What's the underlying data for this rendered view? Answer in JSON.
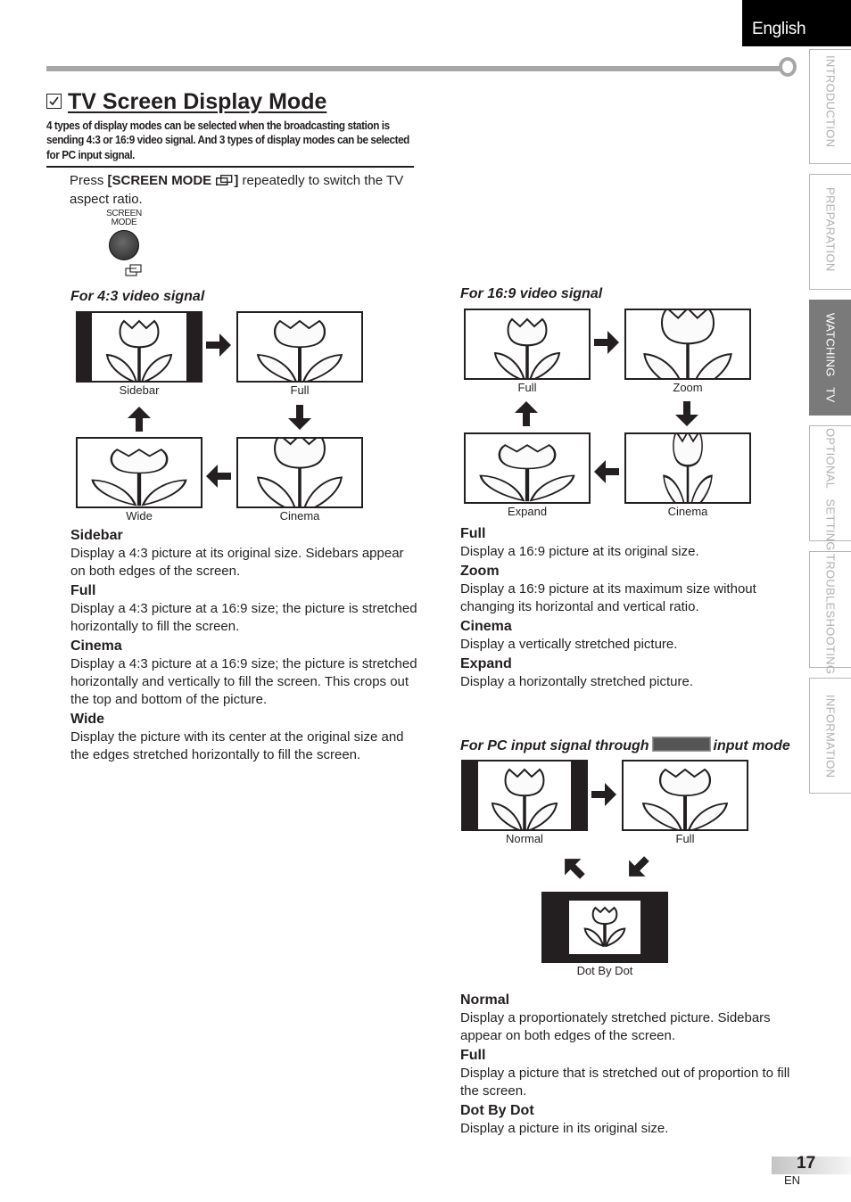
{
  "language_tab": "English",
  "side_tabs": [
    {
      "label": "INTRODUCTION",
      "active": false
    },
    {
      "label": "PREPARATION",
      "active": false
    },
    {
      "label": "WATCHING   TV",
      "active": true
    },
    {
      "label": "OPTIONAL   SETTING",
      "active": false
    },
    {
      "label": "TROUBLESHOOTING",
      "active": false
    },
    {
      "label": "INFORMATION",
      "active": false
    }
  ],
  "title": "TV Screen Display Mode",
  "intro": "4 types of display modes can be selected when the broadcasting station is sending 4:3 or 16:9 video signal. And 3 types of display modes can be selected for PC input signal.",
  "instruction": {
    "press": "Press ",
    "button_name": "[SCREEN MODE",
    "button_close": "]",
    "rest": " repeatedly to switch the TV aspect ratio."
  },
  "remote_button": {
    "label_line1": "SCREEN",
    "label_line2": "MODE",
    "icon": "screen-mode-icon"
  },
  "section_43": {
    "heading": "For 4:3 video signal",
    "diagrams": [
      "Sidebar",
      "Full",
      "Wide",
      "Cinema"
    ],
    "descriptions": [
      {
        "name": "Sidebar",
        "text": "Display a 4:3 picture at its original size. Sidebars appear on both edges of the screen."
      },
      {
        "name": "Full",
        "text": "Display a 4:3 picture at a 16:9 size; the picture is stretched horizontally to fill the screen."
      },
      {
        "name": "Cinema",
        "text": "Display a 4:3 picture at a 16:9 size; the picture is stretched horizontally and vertically to fill the screen. This crops out the top and bottom of the picture."
      },
      {
        "name": "Wide",
        "text": "Display the picture with its center at the original size and the edges stretched horizontally to fill the screen."
      }
    ]
  },
  "section_169": {
    "heading": "For 16:9 video signal",
    "diagrams": [
      "Full",
      "Zoom",
      "Expand",
      "Cinema"
    ],
    "descriptions": [
      {
        "name": "Full",
        "text": "Display a 16:9 picture at its original size."
      },
      {
        "name": "Zoom",
        "text": "Display a 16:9 picture at its maximum size without changing its horizontal and vertical ratio."
      },
      {
        "name": "Cinema",
        "text": "Display a vertically stretched picture."
      },
      {
        "name": "Expand",
        "text": "Display a horizontally stretched picture."
      }
    ]
  },
  "section_pc": {
    "heading_before": "For PC input signal through",
    "heading_after": "input mode",
    "diagrams": [
      "Normal",
      "Full",
      "Dot By Dot"
    ],
    "descriptions": [
      {
        "name": "Normal",
        "text": "Display a proportionately stretched picture. Sidebars appear on both edges of the screen."
      },
      {
        "name": "Full",
        "text": "Display a picture that is stretched out of proportion to fill the screen."
      },
      {
        "name": "Dot By Dot",
        "text": "Display a picture in its original size."
      }
    ]
  },
  "page": {
    "number": "17",
    "lang": "EN"
  }
}
